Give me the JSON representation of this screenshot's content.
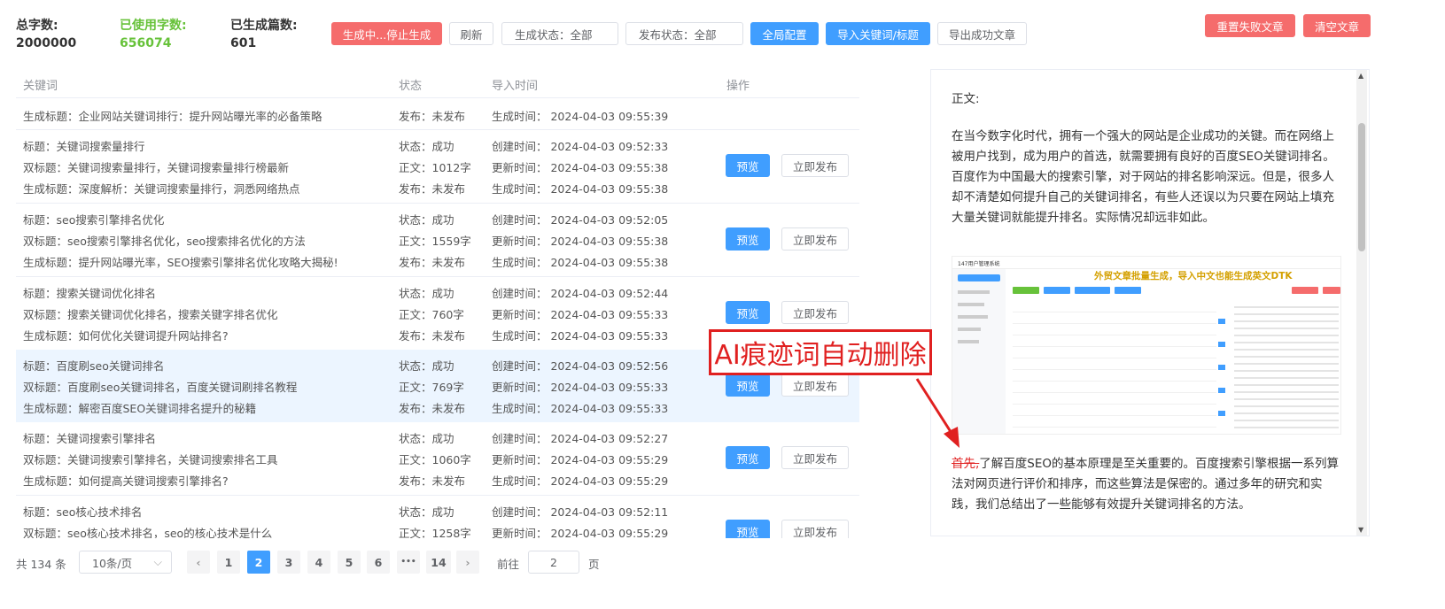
{
  "stats": {
    "total_label": "总字数:",
    "total_value": "2000000",
    "used_label": "已使用字数:",
    "used_value": "656074",
    "generated_label": "已生成篇数:",
    "generated_value": "601"
  },
  "toolbar": {
    "stop_label": "生成中...停止生成",
    "refresh_label": "刷新",
    "gen_status_label": "生成状态：全部",
    "pub_status_label": "发布状态：全部",
    "config_label": "全局配置",
    "import_label": "导入关键词/标题",
    "export_label": "导出成功文章",
    "reset_failed_label": "重置失败文章",
    "clear_label": "清空文章"
  },
  "table": {
    "headers": [
      "关键词",
      "状态",
      "导入时间",
      "操作"
    ],
    "partial": {
      "gen": "生成标题：企业网站关键词排行：提升网站曝光率的必备策略",
      "pub": "发布：未发布",
      "gentime": "生成时间：  2024-04-03 09:55:39"
    },
    "preview_label": "预览",
    "publish_label": "立即发布",
    "rows": [
      {
        "title": "标题：关键词搜索量排行",
        "double": "双标题：关键词搜索量排行，关键词搜索量排行榜最新",
        "gen": "生成标题：深度解析：关键词搜索量排行，洞悉网络热点",
        "status": "状态：成功",
        "words": "正文：1012字",
        "pub": "发布：未发布",
        "created": "创建时间：  2024-04-03 09:52:33",
        "updated": "更新时间：  2024-04-03 09:55:38",
        "gentime": "生成时间：  2024-04-03 09:55:38"
      },
      {
        "title": "标题：seo搜索引擎排名优化",
        "double": "双标题：seo搜索引擎排名优化，seo搜索排名优化的方法",
        "gen": "生成标题：提升网站曝光率，SEO搜索引擎排名优化攻略大揭秘!",
        "status": "状态：成功",
        "words": "正文：1559字",
        "pub": "发布：未发布",
        "created": "创建时间：  2024-04-03 09:52:05",
        "updated": "更新时间：  2024-04-03 09:55:38",
        "gentime": "生成时间：  2024-04-03 09:55:38"
      },
      {
        "title": "标题：搜索关键词优化排名",
        "double": "双标题：搜索关键词优化排名，搜索关键字排名优化",
        "gen": "生成标题：如何优化关键词提升网站排名?",
        "status": "状态：成功",
        "words": "正文：760字",
        "pub": "发布：未发布",
        "created": "创建时间：  2024-04-03 09:52:44",
        "updated": "更新时间：  2024-04-03 09:55:33",
        "gentime": "生成时间：  2024-04-03 09:55:33"
      },
      {
        "title": "标题：百度刷seo关键词排名",
        "double": "双标题：百度刷seo关键词排名，百度关键词刷排名教程",
        "gen": "生成标题：解密百度SEO关键词排名提升的秘籍",
        "status": "状态：成功",
        "words": "正文：769字",
        "pub": "发布：未发布",
        "created": "创建时间：  2024-04-03 09:52:56",
        "updated": "更新时间：  2024-04-03 09:55:33",
        "gentime": "生成时间：  2024-04-03 09:55:33"
      },
      {
        "title": "标题：关键词搜索引擎排名",
        "double": "双标题：关键词搜索引擎排名，关键词搜索排名工具",
        "gen": "生成标题：如何提高关键词搜索引擎排名?",
        "status": "状态：成功",
        "words": "正文：1060字",
        "pub": "发布：未发布",
        "created": "创建时间：  2024-04-03 09:52:27",
        "updated": "更新时间：  2024-04-03 09:55:29",
        "gentime": "生成时间：  2024-04-03 09:55:29"
      },
      {
        "title": "标题：seo核心技术排名",
        "double": "双标题：seo核心技术排名，seo的核心技术是什么",
        "gen": "",
        "status": "状态：成功",
        "words": "正文：1258字",
        "pub": "",
        "created": "创建时间：  2024-04-03 09:52:11",
        "updated": "更新时间：  2024-04-03 09:55:29",
        "gentime": ""
      }
    ]
  },
  "pagination": {
    "total": "共 134 条",
    "page_size": "10条/页",
    "pages": [
      "1",
      "2",
      "3",
      "4",
      "5",
      "6",
      "•••",
      "14"
    ],
    "goto_label": "前往",
    "goto_value": "2",
    "page_suffix": "页"
  },
  "preview": {
    "label": "正文:",
    "para1": "在当今数字化时代，拥有一个强大的网站是企业成功的关键。而在网络上被用户找到，成为用户的首选，就需要拥有良好的百度SEO关键词排名。百度作为中国最大的搜索引擎，对于网站的排名影响深远。但是，很多人却不清楚如何提升自己的关键词排名，有些人还误以为只要在网站上填充大量关键词就能提升排名。实际情况却远非如此。",
    "strike": "首先,",
    "para2": "了解百度SEO的基本原理是至关重要的。百度搜索引擎根据一系列算法对网页进行评价和排序，而这些算法是保密的。通过多年的研究和实践，我们总结出了一些能够有效提升关键词排名的方法。",
    "shot_banner": "外贸文章批量生成，导入中文也能生成英文DTK",
    "shot_app": "147用户管理系统",
    "callout": "AI痕迹词自动删除"
  },
  "colors": {
    "red": "#f56c6c",
    "blue": "#409eff",
    "green": "#67c23a",
    "callout": "#e02020"
  }
}
